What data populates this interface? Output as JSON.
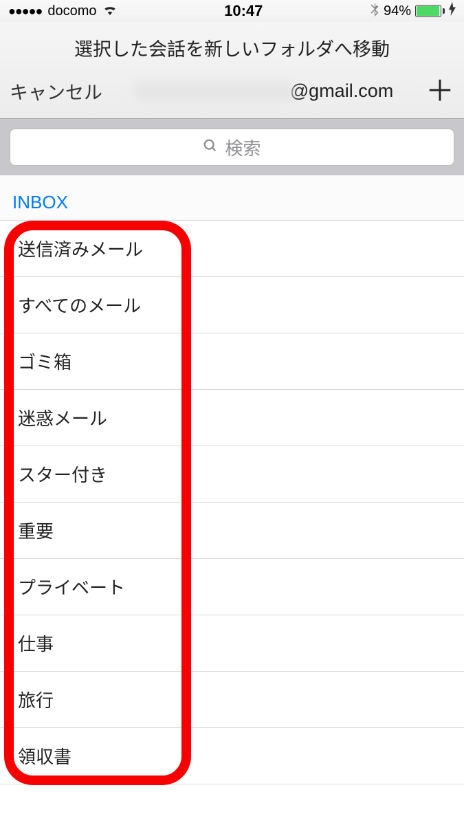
{
  "status": {
    "signal_dots": "●●●●●",
    "carrier": "docomo",
    "time": "10:47",
    "battery_pct": "94%"
  },
  "header": {
    "title": "選択した会話を新しいフォルダへ移動",
    "cancel": "キャンセル",
    "email_domain": "@gmail.com"
  },
  "search": {
    "placeholder": "検索"
  },
  "section_header": "INBOX",
  "folders": [
    "送信済みメール",
    "すべてのメール",
    "ゴミ箱",
    "迷惑メール",
    "スター付き",
    "重要",
    "プライベート",
    "仕事",
    "旅行",
    "領収書"
  ]
}
